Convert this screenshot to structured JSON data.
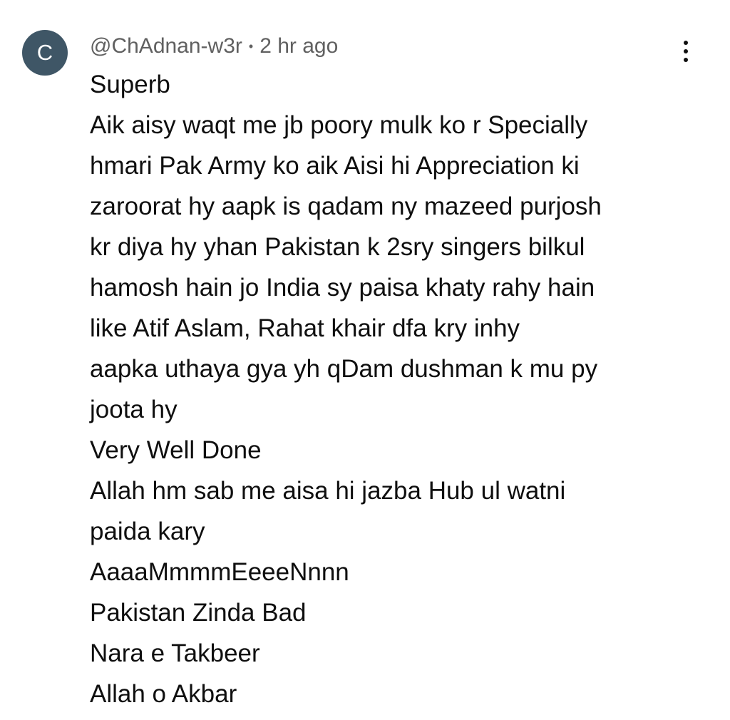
{
  "comment": {
    "avatar_letter": "C",
    "author": "@ChAdnan-w3r",
    "separator": "•",
    "timestamp": "2 hr ago",
    "lines": [
      "Superb",
      "Aik aisy waqt me jb poory mulk ko r Specially",
      "hmari Pak Army ko aik Aisi hi Appreciation ki",
      "zaroorat hy aapk is qadam ny mazeed purjosh",
      "kr diya hy yhan Pakistan k 2sry singers bilkul",
      "hamosh hain jo India sy paisa khaty rahy hain",
      "like Atif Aslam, Rahat khair dfa kry inhy",
      "aapka uthaya gya yh qDam dushman k mu py",
      "joota hy",
      "Very Well Done",
      "Allah hm sab me aisa hi jazba Hub ul watni",
      "paida kary",
      "AaaaMmmmEeeeNnnn",
      "Pakistan Zinda Bad",
      "Nara e Takbeer",
      "Allah o Akbar"
    ],
    "menu_icon": "more-vert-icon"
  },
  "colors": {
    "avatar_bg": "#3f5666",
    "meta_text": "#606060",
    "body_text": "#0f0f0f"
  }
}
